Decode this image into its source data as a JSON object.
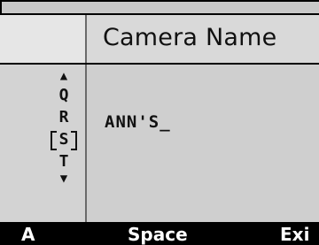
{
  "header": {
    "title": "Camera Name"
  },
  "selector": {
    "up_icon": "up-triangle",
    "down_icon": "down-triangle",
    "letters": [
      "Q",
      "R",
      "S",
      "T"
    ],
    "selected": "S"
  },
  "entry": {
    "text": "ANN'S",
    "cursor": "_"
  },
  "softkeys": {
    "left": "A",
    "middle": "Space",
    "right": "Exi"
  }
}
